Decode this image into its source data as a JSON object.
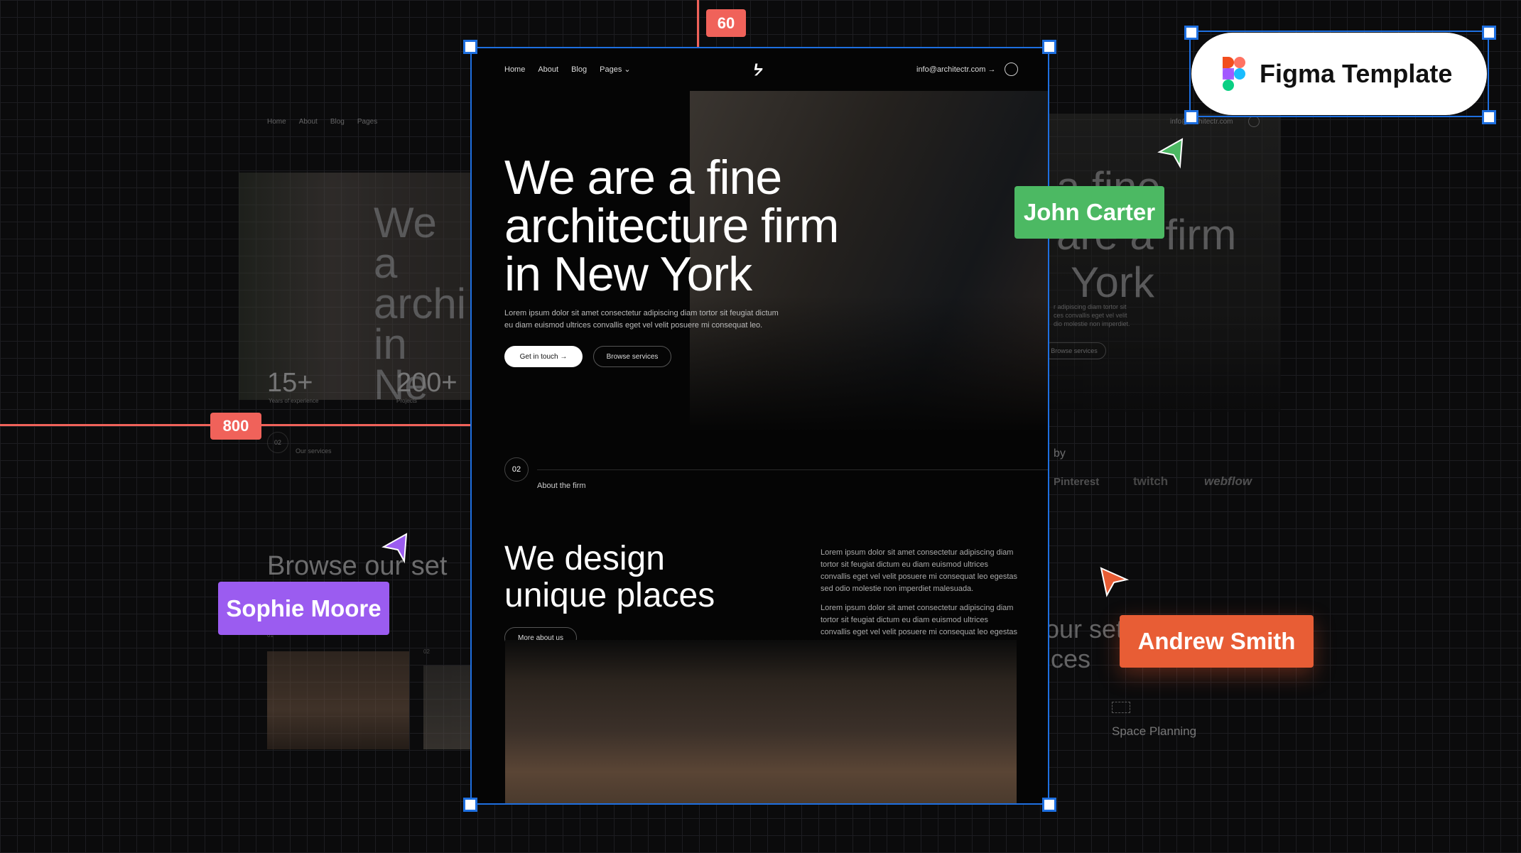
{
  "canvas": {
    "ruler_top": "60",
    "ruler_left": "800",
    "figma_badge": "Figma Template",
    "cursors": [
      {
        "name": "John Carter",
        "color": "#4cb963"
      },
      {
        "name": "Sophie Moore",
        "color": "#9b5cf0"
      },
      {
        "name": "Andrew Smith",
        "color": "#e85d35"
      }
    ],
    "accent": "#1e6fe0"
  },
  "ghost_left": {
    "nav": [
      "Home",
      "About",
      "Blog",
      "Pages"
    ],
    "headline": [
      "We a",
      "archi",
      "in Ne"
    ],
    "stats": [
      {
        "value": "15+",
        "label": "Years of experience"
      },
      {
        "value": "200+",
        "label": "Projects"
      }
    ],
    "section_num": "02",
    "section_label": "Our services",
    "heading": [
      "Browse our set",
      "s"
    ],
    "card_nums": [
      "01",
      "02"
    ]
  },
  "ghost_right": {
    "email": "info@architectr.com",
    "headline": [
      "a fine",
      "are a firm",
      "York"
    ],
    "paragraph": [
      "r adipiscing diam tortor sit",
      "ces convallis eget vel velit",
      "dio molestie non imperdiet."
    ],
    "button": "Browse services",
    "by": "by",
    "logos": [
      "Pinterest",
      "twitch",
      "webflow"
    ],
    "heading": [
      "our set",
      "ices"
    ],
    "service": "Space Planning"
  },
  "main": {
    "nav": {
      "items": [
        "Home",
        "About",
        "Blog",
        "Pages"
      ],
      "email": "info@architectr.com"
    },
    "hero": {
      "title": [
        "We are a fine",
        "architecture firm",
        "in New York"
      ],
      "paragraph": [
        "Lorem ipsum dolor sit amet consectetur adipiscing diam tortor sit feugiat dictum",
        "eu diam euismod ultrices convallis eget vel velit posuere mi consequat leo."
      ],
      "primary_button": "Get in touch",
      "secondary_button": "Browse services"
    },
    "about": {
      "num": "02",
      "label": "About the firm",
      "title": [
        "We design",
        "unique places"
      ],
      "paragraphs": [
        "Lorem ipsum dolor sit amet consectetur adipiscing diam tortor sit feugiat dictum eu diam euismod ultrices convallis eget vel velit posuere mi consequat leo egestas sed odio molestie non imperdiet malesuada.",
        "Lorem ipsum dolor sit amet consectetur adipiscing diam tortor sit feugiat dictum eu diam euismod ultrices convallis eget vel velit posuere mi consequat leo egestas sed odio molestie non imperdiet malesuada."
      ],
      "button": "More about us"
    }
  }
}
